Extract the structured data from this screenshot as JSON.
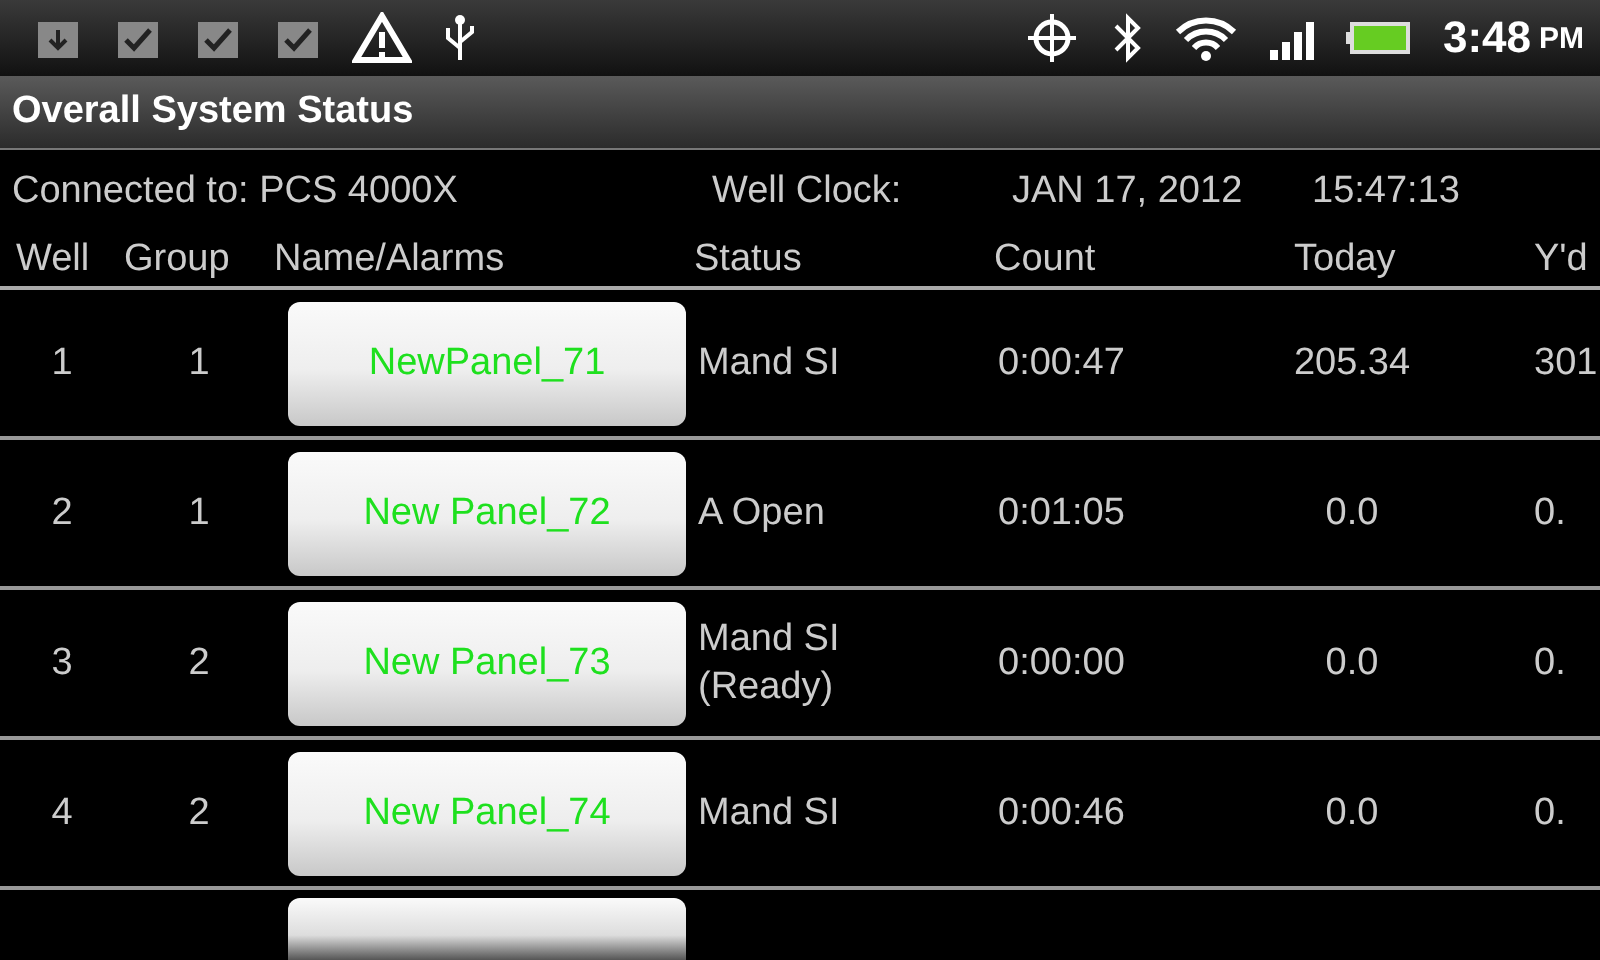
{
  "status_bar": {
    "time": "3:48",
    "meridiem": "PM"
  },
  "title": "Overall System Status",
  "info": {
    "connected_label": "Connected to: PCS 4000X",
    "clock_label": "Well Clock:",
    "date": "JAN 17, 2012",
    "time": "15:47:13"
  },
  "columns": [
    "Well",
    "Group",
    "Name/Alarms",
    "Status",
    "Count",
    "Today",
    "Y'd"
  ],
  "rows": [
    {
      "well": "1",
      "group": "1",
      "name": "NewPanel_71",
      "status": "Mand SI",
      "count": "0:00:47",
      "today": "205.34",
      "yesterday": "301"
    },
    {
      "well": "2",
      "group": "1",
      "name": "New Panel_72",
      "status": "A Open",
      "count": "0:01:05",
      "today": "0.0",
      "yesterday": "0."
    },
    {
      "well": "3",
      "group": "2",
      "name": "New Panel_73",
      "status": "Mand SI (Ready)",
      "count": "0:00:00",
      "today": "0.0",
      "yesterday": "0."
    },
    {
      "well": "4",
      "group": "2",
      "name": "New Panel_74",
      "status": "Mand SI",
      "count": "0:00:46",
      "today": "0.0",
      "yesterday": "0."
    }
  ],
  "more_rows_below": true
}
